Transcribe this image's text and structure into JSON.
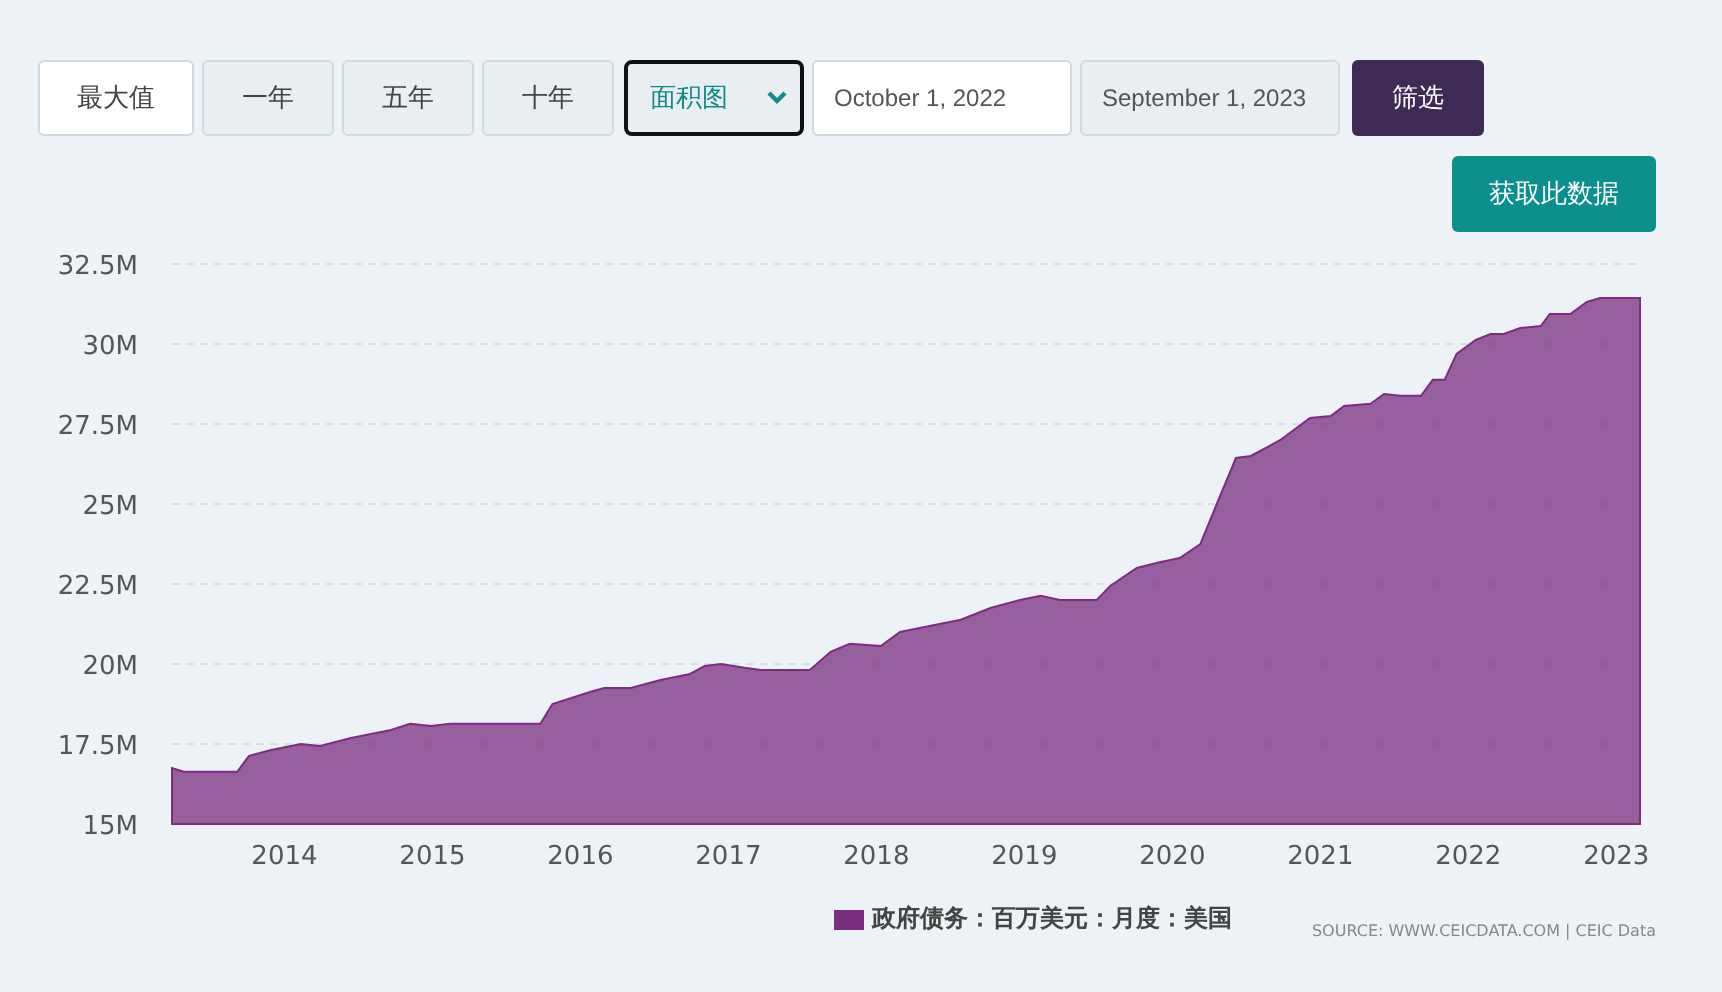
{
  "range_buttons": [
    {
      "label": "最大值",
      "selected": true
    },
    {
      "label": "一年",
      "selected": false
    },
    {
      "label": "五年",
      "selected": false
    },
    {
      "label": "十年",
      "selected": false
    }
  ],
  "chart_type_select": {
    "value": "面积图"
  },
  "date_fields": [
    {
      "value": "October 1, 2022",
      "focused": true
    },
    {
      "value": "September 1, 2023",
      "focused": false
    }
  ],
  "filter_button": "筛选",
  "get_data_button": "获取此数据",
  "chart": {
    "chart_data": {
      "type": "area",
      "grid": true,
      "xlim": [
        2013.24,
        2023.16
      ],
      "ylim": [
        15,
        32.5
      ],
      "xticks": [
        2014,
        2015,
        2016,
        2017,
        2018,
        2019,
        2020,
        2021,
        2022,
        2023
      ],
      "yticks": [
        {
          "value": 15,
          "label": "15M"
        },
        {
          "value": 17.5,
          "label": "17.5M"
        },
        {
          "value": 20,
          "label": "20M"
        },
        {
          "value": 22.5,
          "label": "22.5M"
        },
        {
          "value": 25,
          "label": "25M"
        },
        {
          "value": 27.5,
          "label": "27.5M"
        },
        {
          "value": 30,
          "label": "30M"
        },
        {
          "value": 32.5,
          "label": "32.5M"
        }
      ],
      "x": [
        2013.24,
        2013.32,
        2013.68,
        2013.76,
        2013.91,
        2014.11,
        2014.24,
        2014.45,
        2014.72,
        2014.85,
        2014.99,
        2015.12,
        2015.73,
        2015.81,
        2016.07,
        2016.16,
        2016.34,
        2016.54,
        2016.74,
        2016.84,
        2016.95,
        2017.11,
        2017.22,
        2017.55,
        2017.69,
        2017.82,
        2018.03,
        2018.16,
        2018.36,
        2018.57,
        2018.77,
        2018.97,
        2019.11,
        2019.24,
        2019.49,
        2019.58,
        2019.76,
        2019.92,
        2020.05,
        2020.19,
        2020.3,
        2020.43,
        2020.53,
        2020.73,
        2020.93,
        2021.07,
        2021.16,
        2021.34,
        2021.43,
        2021.54,
        2021.68,
        2021.76,
        2021.84,
        2021.92,
        2022.05,
        2022.15,
        2022.24,
        2022.35,
        2022.49,
        2022.55,
        2022.69,
        2022.8,
        2022.89,
        2023.16
      ],
      "series": [
        {
          "name": "政府债务：百万美元：月度：美国",
          "color": "#7b2d82",
          "values": [
            16.75,
            16.63,
            16.63,
            17.13,
            17.31,
            17.5,
            17.44,
            17.69,
            17.94,
            18.13,
            18.06,
            18.13,
            18.13,
            18.75,
            19.13,
            19.25,
            19.25,
            19.5,
            19.69,
            19.94,
            20.0,
            19.88,
            19.81,
            19.81,
            20.38,
            20.63,
            20.56,
            21.0,
            21.19,
            21.38,
            21.75,
            22.0,
            22.13,
            22.0,
            22.0,
            22.44,
            23.0,
            23.19,
            23.31,
            23.75,
            25.0,
            26.44,
            26.5,
            27.0,
            27.69,
            27.75,
            28.06,
            28.13,
            28.44,
            28.38,
            28.38,
            28.88,
            28.88,
            29.69,
            30.13,
            30.31,
            30.31,
            30.5,
            30.56,
            30.94,
            30.94,
            31.31,
            31.44,
            31.44
          ]
        }
      ]
    },
    "source": "SOURCE: WWW.CEICDATA.COM | CEIC Data"
  }
}
